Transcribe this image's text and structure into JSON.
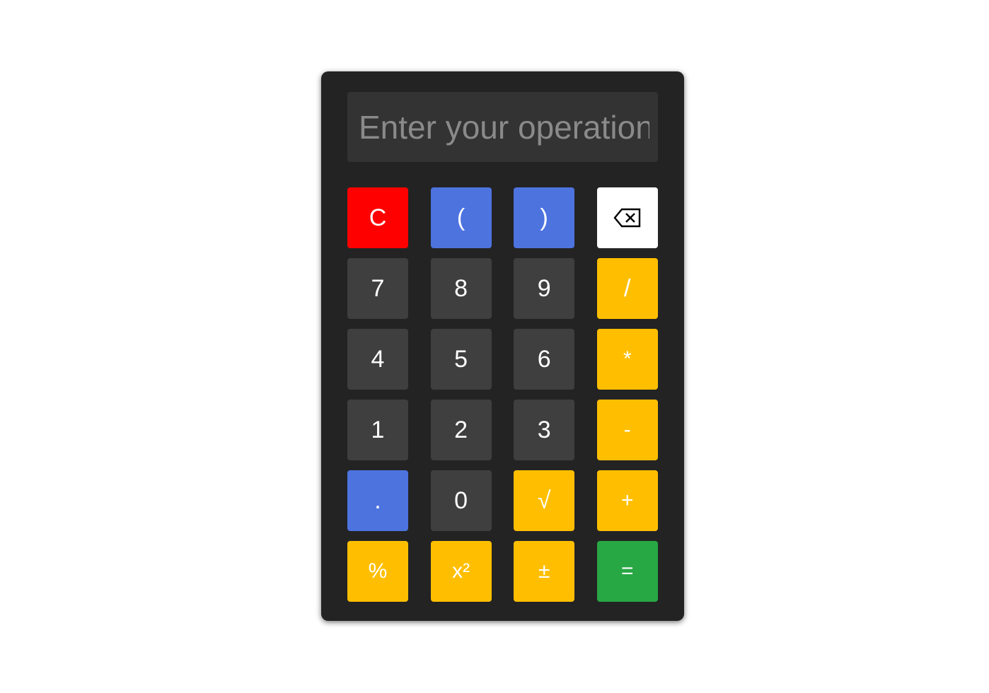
{
  "display": {
    "value": "",
    "placeholder": "Enter your operation"
  },
  "colors": {
    "panel": "#232323",
    "display": "#333333",
    "red": "#ff0000",
    "blue": "#4d73df",
    "white": "#ffffff",
    "dark": "#3f3f3f",
    "yellow": "#ffbf00",
    "green": "#28a745"
  },
  "keys": [
    {
      "label": "C",
      "name": "clear-button",
      "style": "red"
    },
    {
      "label": "(",
      "name": "open-paren-button",
      "style": "blue"
    },
    {
      "label": ")",
      "name": "close-paren-button",
      "style": "blue"
    },
    {
      "label": "",
      "name": "backspace-button",
      "style": "white",
      "icon": "backspace-icon"
    },
    {
      "label": "7",
      "name": "digit-7-button",
      "style": "dark"
    },
    {
      "label": "8",
      "name": "digit-8-button",
      "style": "dark"
    },
    {
      "label": "9",
      "name": "digit-9-button",
      "style": "dark"
    },
    {
      "label": "/",
      "name": "divide-button",
      "style": "yellow"
    },
    {
      "label": "4",
      "name": "digit-4-button",
      "style": "dark"
    },
    {
      "label": "5",
      "name": "digit-5-button",
      "style": "dark"
    },
    {
      "label": "6",
      "name": "digit-6-button",
      "style": "dark"
    },
    {
      "label": "*",
      "name": "multiply-button",
      "style": "yellow"
    },
    {
      "label": "1",
      "name": "digit-1-button",
      "style": "dark"
    },
    {
      "label": "2",
      "name": "digit-2-button",
      "style": "dark"
    },
    {
      "label": "3",
      "name": "digit-3-button",
      "style": "dark"
    },
    {
      "label": "-",
      "name": "subtract-button",
      "style": "yellow"
    },
    {
      "label": ".",
      "name": "decimal-button",
      "style": "blue"
    },
    {
      "label": "0",
      "name": "digit-0-button",
      "style": "dark"
    },
    {
      "label": "√",
      "name": "square-root-button",
      "style": "yellow"
    },
    {
      "label": "+",
      "name": "add-button",
      "style": "yellow"
    },
    {
      "label": "%",
      "name": "percent-button",
      "style": "yellow"
    },
    {
      "label": "x²",
      "name": "square-button",
      "style": "yellow"
    },
    {
      "label": "±",
      "name": "plus-minus-button",
      "style": "yellow"
    },
    {
      "label": "=",
      "name": "equals-button",
      "style": "green"
    }
  ]
}
